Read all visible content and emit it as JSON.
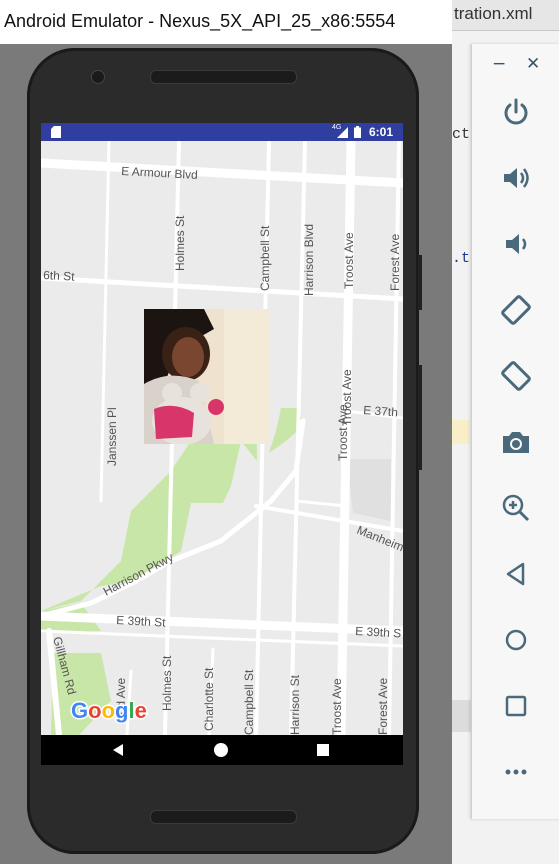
{
  "window": {
    "title": "Android Emulator - Nexus_5X_API_25_x86:5554"
  },
  "ide": {
    "tab_label": "tration.xml",
    "code_fragment_1": "ct",
    "code_fragment_2": ".t"
  },
  "panel": {
    "minimize_glyph": "−",
    "close_glyph": "✕",
    "controls": [
      "power-icon",
      "volume-up-icon",
      "volume-down-icon",
      "rotate-left-icon",
      "rotate-right-icon",
      "camera-icon",
      "zoom-icon",
      "back-icon",
      "home-icon",
      "overview-icon",
      "more-icon"
    ]
  },
  "status_bar": {
    "network": "4G",
    "time": "6:01"
  },
  "map": {
    "roads": {
      "armour": "E Armour Blvd",
      "sixth": "6th St",
      "holmes_top": "Holmes St",
      "campbell_top": "Campbell St",
      "harrison_blvd": "Harrison Blvd",
      "troost_top": "Troost Ave",
      "forest_top": "Forest Ave",
      "janssen": "Janssen Pl",
      "troost_mid1": "Troost Ave",
      "troost_mid2": "Troost Ave",
      "e37": "E 37th",
      "manheim": "Manheim",
      "harrison_pkwy": "Harrison Pkwy",
      "e39_left": "E 39th St",
      "e39_right": "E 39th S",
      "gillham": "Gillham Rd",
      "oodland": "ood Ave",
      "holmes_bot": "Holmes St",
      "charlotte": "Charlotte St",
      "campbell_bot": "Campbell St",
      "harrison_bot": "Harrison St",
      "troost_bot": "Troost Ave",
      "forest_bot": "Forest Ave"
    },
    "logo": "Google",
    "logo_colors": [
      "#4285f4",
      "#ea4335",
      "#fbbc05",
      "#4285f4",
      "#34a853",
      "#ea4335"
    ],
    "park_color": "#c8e6a8",
    "road_color": "#ffffff"
  },
  "accent": {
    "status_bar": "#303f9f"
  }
}
